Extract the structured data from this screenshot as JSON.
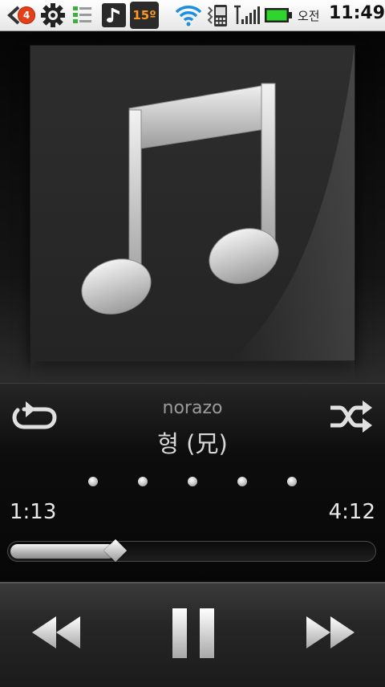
{
  "status_bar": {
    "notification_count": "4",
    "temperature": "15º",
    "ampm": "오전",
    "time": "11:49",
    "icons": [
      "back-notification-icon",
      "settings-gear-icon",
      "task-list-icon",
      "music-note-icon",
      "weather-icon",
      "wifi-icon",
      "phone-signal-icon",
      "cell-signal-icon",
      "battery-icon"
    ],
    "battery_color": "#2fd42f",
    "wifi_color": "#1c8fe0"
  },
  "album_art": {
    "icon": "music-note-icon"
  },
  "now_playing": {
    "artist": "norazo",
    "title": "형 (兄)",
    "page_count": 5,
    "elapsed": "1:13",
    "total": "4:12",
    "progress": 0.29
  },
  "controls": {
    "repeat_icon": "repeat-icon",
    "shuffle_icon": "shuffle-icon",
    "previous_icon": "rewind-icon",
    "pause_icon": "pause-icon",
    "next_icon": "fast-forward-icon"
  }
}
